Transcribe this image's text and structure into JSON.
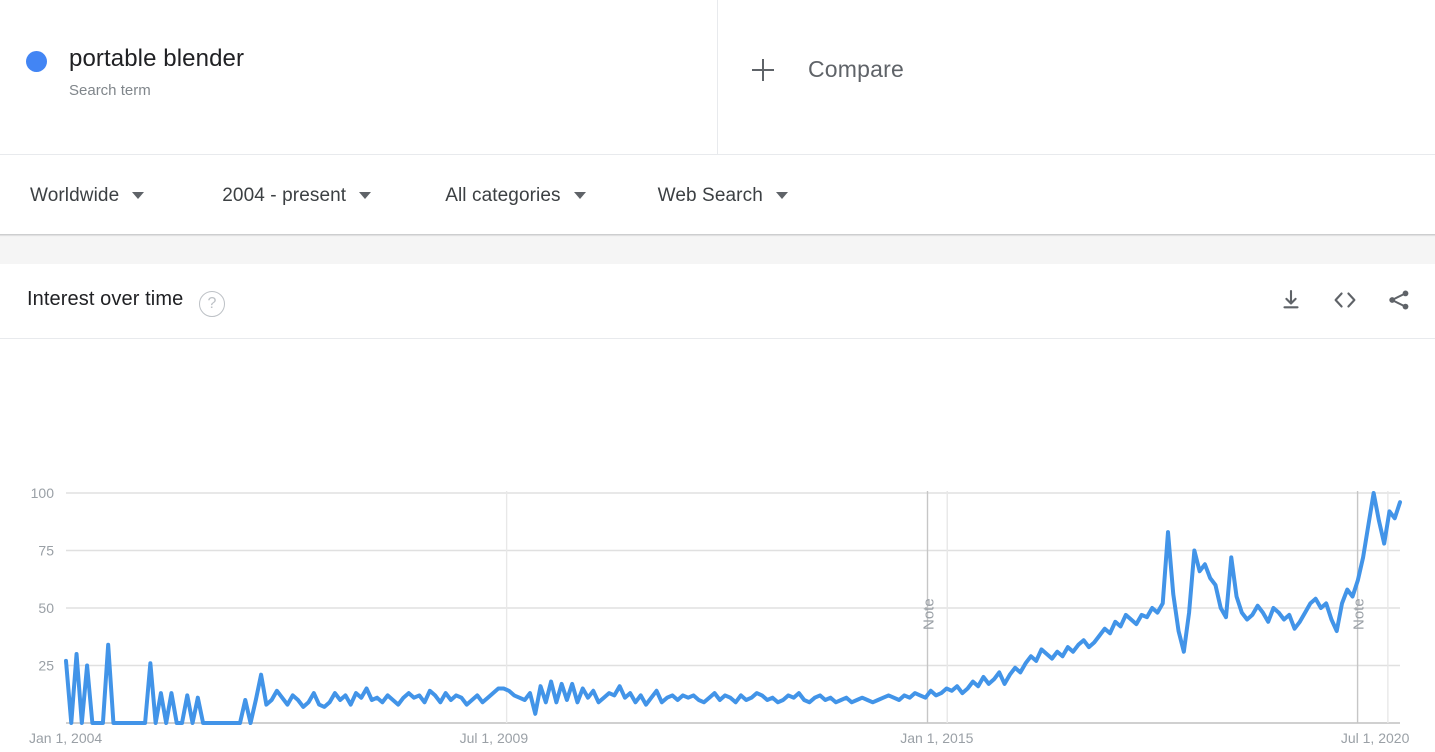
{
  "search_term": {
    "name": "portable blender",
    "type_label": "Search term",
    "dot_color": "#4285f4"
  },
  "compare": {
    "label": "Compare",
    "plus_icon": "plus-icon"
  },
  "filters": [
    {
      "label": "Worldwide",
      "icon": "chevron-down-icon"
    },
    {
      "label": "2004 - present",
      "icon": "chevron-down-icon"
    },
    {
      "label": "All categories",
      "icon": "chevron-down-icon"
    },
    {
      "label": "Web Search",
      "icon": "chevron-down-icon"
    }
  ],
  "interest_over_time": {
    "title": "Interest over time",
    "help_icon": "help-circle-icon",
    "help_glyph": "?",
    "actions": [
      {
        "name": "download-icon",
        "tooltip": "Download"
      },
      {
        "name": "embed-code-icon",
        "tooltip": "Embed"
      },
      {
        "name": "share-icon",
        "tooltip": "Share"
      }
    ]
  },
  "chart_data": {
    "type": "line",
    "title": "Interest over time",
    "xlabel": "",
    "ylabel": "",
    "ylim": [
      0,
      100
    ],
    "yticks": [
      100,
      75,
      50,
      25
    ],
    "xticks": [
      "Jan 1, 2004",
      "Jul 1, 2009",
      "Jan 1, 2015",
      "Jul 1, 2020"
    ],
    "xtick_positions": [
      0,
      0.3303,
      0.6606,
      0.9909
    ],
    "grid": true,
    "legend_position": "top",
    "line_color": "#4294e8",
    "line_width": 4,
    "annotations": [
      {
        "label": "Note",
        "x_fraction": 0.6458,
        "name": "note-marker-1"
      },
      {
        "label": "Note",
        "x_fraction": 0.9682,
        "name": "note-marker-2"
      }
    ],
    "series": [
      {
        "name": "portable blender",
        "color": "#4294e8",
        "values": [
          27,
          0,
          30,
          0,
          25,
          0,
          0,
          0,
          34,
          0,
          0,
          0,
          0,
          0,
          0,
          0,
          26,
          0,
          13,
          0,
          13,
          0,
          0,
          12,
          0,
          11,
          0,
          0,
          0,
          0,
          0,
          0,
          0,
          0,
          10,
          0,
          10,
          21,
          8,
          10,
          14,
          11,
          8,
          12,
          10,
          7,
          9,
          13,
          8,
          7,
          9,
          13,
          10,
          12,
          8,
          13,
          11,
          15,
          10,
          11,
          9,
          12,
          10,
          8,
          11,
          13,
          11,
          12,
          9,
          14,
          12,
          9,
          13,
          10,
          12,
          11,
          8,
          10,
          12,
          9,
          11,
          13,
          15,
          15,
          14,
          12,
          11,
          10,
          13,
          4,
          16,
          9,
          18,
          9,
          17,
          10,
          17,
          9,
          15,
          11,
          14,
          9,
          11,
          13,
          12,
          16,
          11,
          13,
          9,
          12,
          8,
          11,
          14,
          9,
          11,
          12,
          10,
          12,
          11,
          12,
          10,
          9,
          11,
          13,
          10,
          12,
          11,
          9,
          12,
          10,
          11,
          13,
          12,
          10,
          11,
          9,
          10,
          12,
          11,
          13,
          10,
          9,
          11,
          12,
          10,
          11,
          9,
          10,
          11,
          9,
          10,
          11,
          10,
          9,
          10,
          11,
          12,
          11,
          10,
          12,
          11,
          13,
          12,
          11,
          14,
          12,
          13,
          15,
          14,
          16,
          13,
          15,
          18,
          16,
          20,
          17,
          19,
          22,
          17,
          21,
          24,
          22,
          26,
          29,
          27,
          32,
          30,
          28,
          31,
          29,
          33,
          31,
          34,
          36,
          33,
          35,
          38,
          41,
          39,
          44,
          42,
          47,
          45,
          43,
          47,
          46,
          50,
          48,
          52,
          83,
          56,
          40,
          31,
          48,
          75,
          66,
          69,
          63,
          60,
          50,
          46,
          72,
          55,
          48,
          45,
          47,
          51,
          48,
          44,
          50,
          48,
          45,
          47,
          41,
          44,
          48,
          52,
          54,
          50,
          52,
          45,
          40,
          52,
          58,
          55,
          62,
          72,
          86,
          100,
          88,
          78,
          92,
          89,
          96
        ]
      }
    ]
  }
}
